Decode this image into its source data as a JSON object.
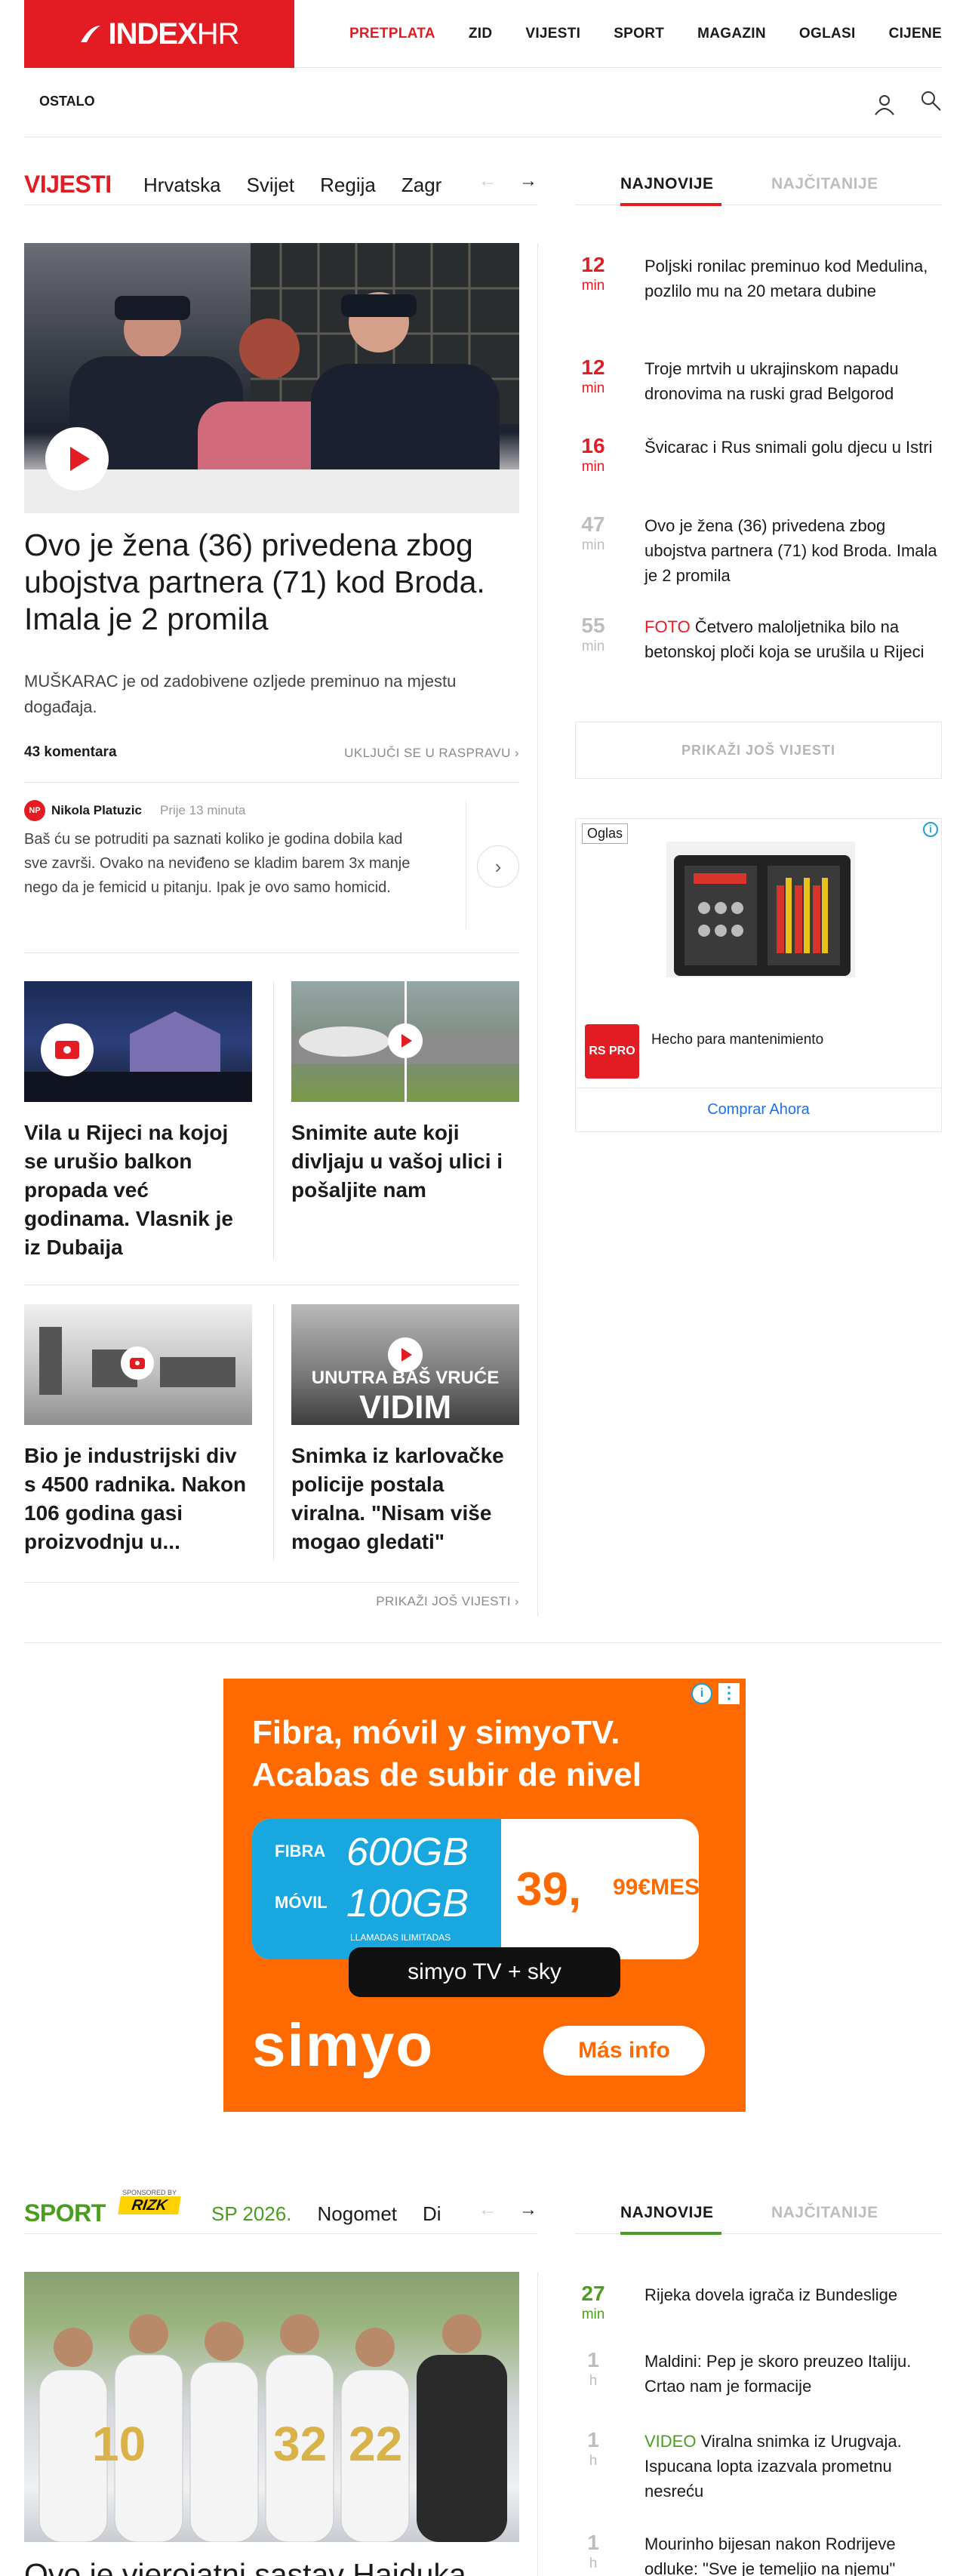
{
  "header": {
    "logo_index": "INDEX",
    "logo_hr": "HR",
    "nav": [
      "PRETPLATA",
      "ZID",
      "VIJESTI",
      "SPORT",
      "MAGAZIN",
      "OGLASI",
      "CIJENE"
    ],
    "ostalo": "OSTALO"
  },
  "vijesti": {
    "title": "VIJESTI",
    "categories": [
      "Hrvatska",
      "Svijet",
      "Regija",
      "Zagr"
    ],
    "prev": "←",
    "next": "→"
  },
  "tabs": {
    "latest": "NAJNOVIJE",
    "most_read": "NAJČITANIJE"
  },
  "lead": {
    "title": "Ovo je žena (36) privedena zbog ubojstva partnera (71) kod Broda. Imala je 2 promila",
    "subtitle": "MUŠKARAC je od zadobivene ozljede preminuo na mjestu događaja.",
    "comments": "43 komentara",
    "join": "UKLJUČI SE U RASPRAVU ›"
  },
  "comment": {
    "initials": "NP",
    "author": "Nikola Platuzic",
    "time": "Prije 13 minuta",
    "text": "Baš ću se potruditi pa saznati koliko je godina dobila kad sve završi. Ovako na neviđeno se kladim barem 3x manje nego da je femicid u pitanju. Ipak je ovo samo homicid.",
    "next": "›"
  },
  "cards": [
    {
      "title": "Vila u Rijeci na kojoj se urušio balkon propada već godinama. Vlasnik je iz Dubaija",
      "media": "camera"
    },
    {
      "title": "Snimite aute koji divljaju u vašoj ulici i pošaljite nam",
      "media": "video"
    },
    {
      "title": "Bio je industrijski div s 4500 radnika. Nakon 106 godina gasi proizvodnju u...",
      "media": "camera"
    },
    {
      "title": "Snimka iz karlovačke policije postala viralna. \"Nisam više mogao gledati\"",
      "media": "video",
      "overlay": "UNUTRA BAŠ VRUĆE",
      "overlay2": "VIDIM"
    }
  ],
  "more_news_link": "PRIKAŽI JOŠ VIJESTI ›",
  "latest": [
    {
      "num": "12",
      "unit": "min",
      "text": "Poljski ronilac preminuo kod Medulina, pozlilo mu na 20 metara dubine",
      "tag": ""
    },
    {
      "num": "12",
      "unit": "min",
      "text": "Troje mrtvih u ukrajinskom napadu dronovima na ruski grad Belgorod",
      "tag": ""
    },
    {
      "num": "16",
      "unit": "min",
      "text": "Švicarac i Rus snimali golu djecu u Istri",
      "tag": ""
    },
    {
      "num": "47",
      "unit": "min",
      "text": "Ovo je žena (36) privedena zbog ubojstva partnera (71) kod Broda. Imala je 2 promila",
      "tag": ""
    },
    {
      "num": "55",
      "unit": "min",
      "text": "Četvero maloljetnika bilo na betonskoj ploči koja se urušila u Rijeci",
      "tag": "FOTO"
    }
  ],
  "more_news_button": "PRIKAŽI JOŠ VIJESTI",
  "ad_small": {
    "label": "Oglas",
    "info": "i",
    "logo": "RS PRO",
    "text": "Hecho para mantenimiento",
    "cta": "Comprar Ahora"
  },
  "banner": {
    "headline_1": "Fibra, móvil y simyoTV.",
    "headline_2": "Acabas de subir de nivel",
    "fibra_label": "FIBRA",
    "fibra_value": "600GB",
    "movil_label": "MÓVIL",
    "movil_value": "100GB",
    "calls": "LLAMADAS ILIMITADAS",
    "price": "39,",
    "price_cents": "99€MES",
    "pill": "simyo TV + sky",
    "brand": "simyo",
    "button": "Más info"
  },
  "sport": {
    "title": "SPORT",
    "sponsored": "SPONSORED BY",
    "sponsor": "RIZK",
    "categories": [
      "SP 2026.",
      "Nogomet",
      "Di"
    ],
    "latest": [
      {
        "num": "27",
        "unit": "min",
        "text": "Rijeka dovela igrača iz Bundeslige",
        "tag": ""
      },
      {
        "num": "1",
        "unit": "h",
        "text": "Maldini: Pep je skoro preuzeo Italiju. Crtao nam je formacije",
        "tag": ""
      },
      {
        "num": "1",
        "unit": "h",
        "text": "Viralna snimka iz Urugvaja. Ispucana lopta izazvala prometnu nesreću",
        "tag": "VIDEO"
      },
      {
        "num": "1",
        "unit": "h",
        "text": "Mourinho bijesan nakon Rodrijeve odluke: \"Sve je temeljio na njemu\"",
        "tag": ""
      }
    ],
    "lead_title": "Ovo je vjerojatni sastav Hajduka"
  },
  "colors": {
    "accent": "#e31b23",
    "sport": "#4a9d1e"
  }
}
